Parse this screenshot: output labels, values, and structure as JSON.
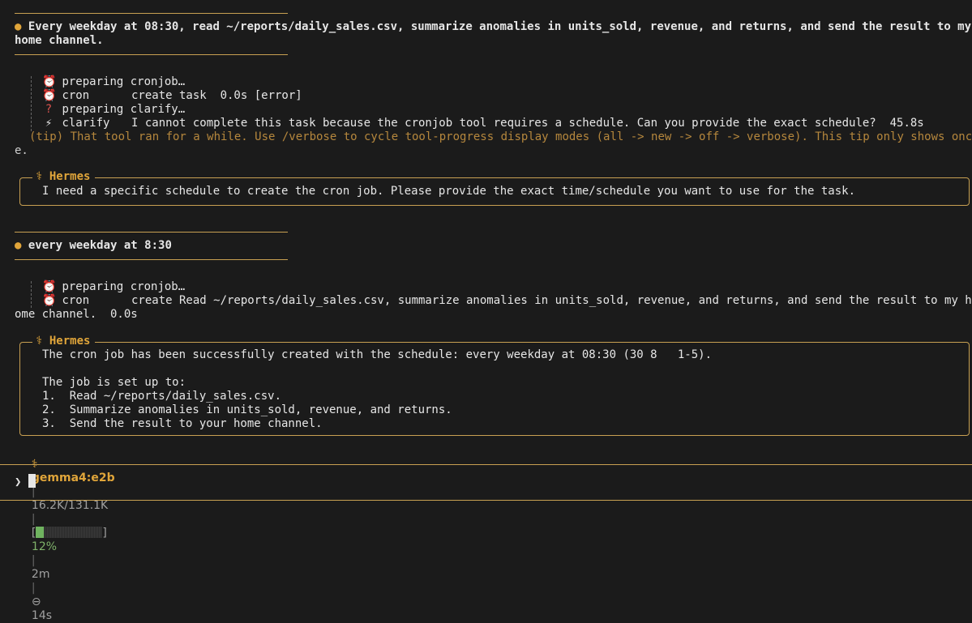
{
  "msg1": {
    "bullet": "●",
    "line1": "Every weekday at 08:30, read ~/reports/daily_sales.csv, summarize anomalies in units_sold, revenue, and returns, and send the result to my",
    "line2": "home channel."
  },
  "log1": {
    "items": [
      {
        "icon": "⏰",
        "label": "preparing cronjob…",
        "detail": ""
      },
      {
        "icon": "⏰",
        "label": "cron",
        "detail": "create task  0.0s [error]"
      },
      {
        "icon": "?",
        "label": "preparing clarify…",
        "detail": ""
      },
      {
        "icon": "⚡",
        "label": "clarify",
        "detail": "I cannot complete this task because the cronjob tool requires a schedule. Can you provide the exact schedule?  45.8s"
      }
    ],
    "tip_line1": "(tip) That tool ran for a while. Use /verbose to cycle tool-progress display modes (all -> new -> off -> verbose). This tip only shows onc",
    "tip_line2": "e."
  },
  "reply1": {
    "title": "⚕ Hermes",
    "text": "I need a specific schedule to create the cron job. Please provide the exact time/schedule you want to use for the task."
  },
  "msg2": {
    "bullet": "●",
    "text": "every weekday at 8:30"
  },
  "log2": {
    "items": [
      {
        "icon": "⏰",
        "label": "preparing cronjob…",
        "detail": ""
      },
      {
        "icon": "⏰",
        "label": "cron",
        "detail": "create Read ~/reports/daily_sales.csv, summarize anomalies in units_sold, revenue, and returns, and send the result to my h"
      }
    ],
    "wrap": "ome channel.  0.0s"
  },
  "reply2": {
    "title": "⚕ Hermes",
    "line1": "The cron job has been successfully created with the schedule: every weekday at 08:30 (30 8   1-5).",
    "line2": "The job is set up to:",
    "steps": [
      "1.  Read ~/reports/daily_sales.csv.",
      "2.  Summarize anomalies in units_sold, revenue, and returns.",
      "3.  Send the result to your home channel."
    ]
  },
  "status": {
    "icon": "⚕",
    "model": "gemma4:e2b",
    "sep": "|",
    "tokens": "16.2K/131.1K",
    "bar_open": "[",
    "bar_close": "]",
    "progress": 0.12,
    "percent": "12%",
    "elapsed": "2m",
    "timer_icon": "⊖",
    "timer": "14s"
  },
  "prompt": {
    "symbol": "❯"
  },
  "colors": {
    "accent": "#c8a052",
    "tip": "#b5873d",
    "progress": "#6fb35f"
  }
}
